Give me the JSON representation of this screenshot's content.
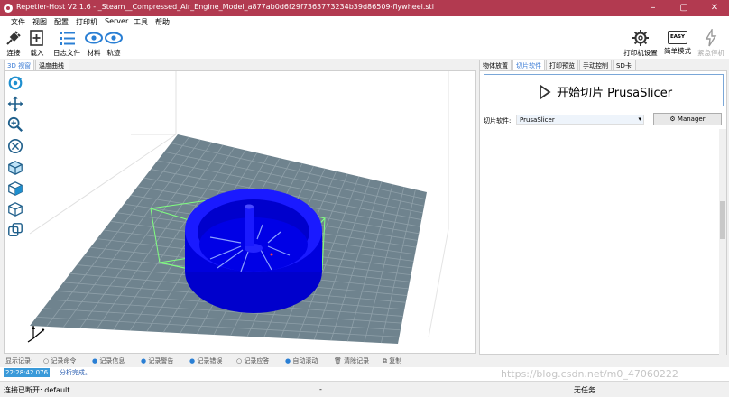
{
  "window": {
    "title": "Repetier-Host V2.1.6 - _Steam__Compressed_Air_Engine_Model_a877ab0d6f29f7363773234b39d86509-flywheel.stl",
    "minimize": "–",
    "maximize": "▢",
    "close": "✕"
  },
  "menu": [
    "文件",
    "视图",
    "配置",
    "打印机",
    "Server",
    "工具",
    "帮助"
  ],
  "toolbar": {
    "connect": "连接",
    "load": "载入",
    "log": "日志文件",
    "material": "材料",
    "track": "轨迹",
    "printer_settings": "打印机设置",
    "easy_mode": "简单模式",
    "easy_badge": "EASY",
    "emergency": "紧急停机"
  },
  "left_tabs": [
    "3D 视窗",
    "温度曲线"
  ],
  "right_tabs": [
    "物体放置",
    "切片软件",
    "打印预览",
    "手动控制",
    "SD卡"
  ],
  "slicer": {
    "slice_button": "开始切片 PrusaSlicer",
    "software_label": "切片软件:",
    "software_value": "PrusaSlicer",
    "manager_label": "Manager"
  },
  "log_toolbar": [
    "显示记录:",
    "记录命令",
    "记录信息",
    "记录警告",
    "记录错误",
    "记录应答",
    "自动滚动",
    "清除记录",
    "复制"
  ],
  "log": {
    "time": "22:28:42.076",
    "message": "分析完成。"
  },
  "status": {
    "connection": "连接已断开: default",
    "middle": "-",
    "job": "无任务"
  },
  "watermark": "https://blog.csdn.net/m0_47060222",
  "colors": {
    "title_bar": "#b23a50",
    "accent": "#3a7bd5",
    "model": "#0000ff",
    "bed": "#6f838e",
    "bbox": "#80ff80"
  }
}
